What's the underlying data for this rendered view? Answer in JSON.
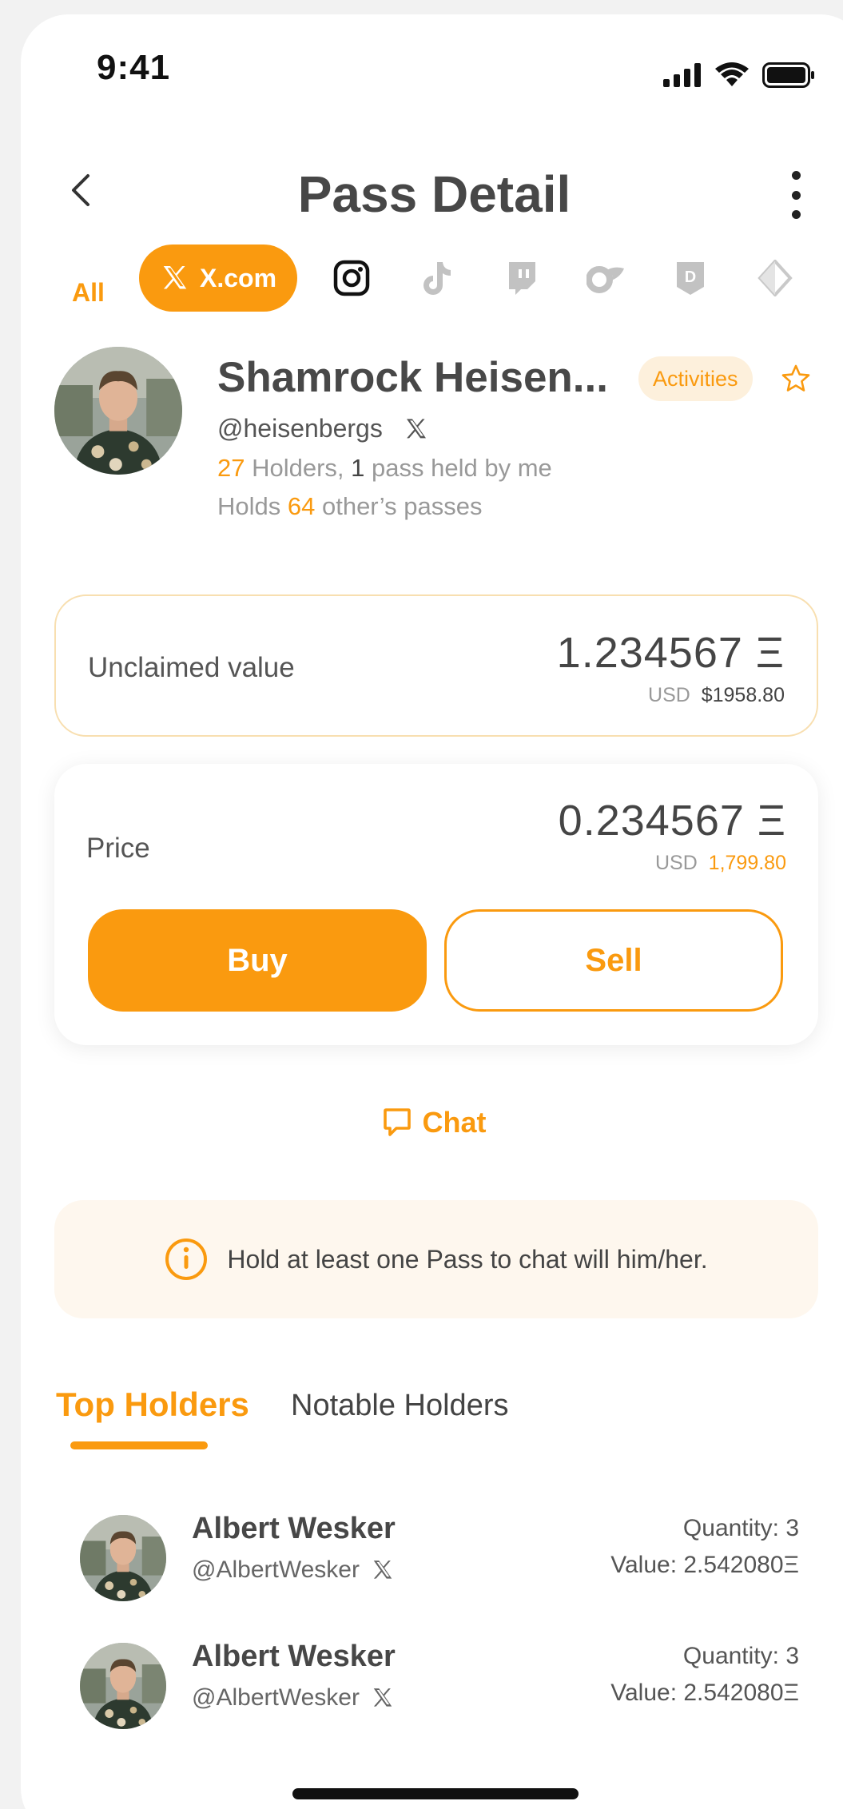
{
  "status_bar": {
    "time": "9:41"
  },
  "header": {
    "title": "Pass Detail"
  },
  "platform_tabs": {
    "all": "All",
    "x": "X.com"
  },
  "profile": {
    "name": "Shamrock Heisen...",
    "handle": "@heisenbergs",
    "activities": "Activities",
    "holders_count": "27",
    "holders_text": " Holders, ",
    "held_by_me": "1",
    "held_text": " pass held by me",
    "holds_prefix": "Holds ",
    "holds_count": "64",
    "holds_suffix": " other’s passes"
  },
  "unclaimed": {
    "label": "Unclaimed value",
    "value": "1.234567 Ξ",
    "usd_label": "USD",
    "usd_value": "$1958.80"
  },
  "price": {
    "label": "Price",
    "value": "0.234567 Ξ",
    "usd_label": "USD",
    "usd_value": "1,799.80"
  },
  "actions": {
    "buy": "Buy",
    "sell": "Sell",
    "chat": "Chat"
  },
  "notice": {
    "text": "Hold at least one Pass to chat will him/her."
  },
  "holder_tabs": {
    "top": "Top Holders",
    "notable": "Notable Holders"
  },
  "holders": [
    {
      "name": "Albert Wesker",
      "handle": "@AlbertWesker",
      "quantity": "Quantity: 3",
      "value": "Value: 2.542080Ξ"
    },
    {
      "name": "Albert Wesker",
      "handle": "@AlbertWesker",
      "quantity": "Quantity: 3",
      "value": "Value: 2.542080Ξ"
    }
  ],
  "colors": {
    "accent": "#fa9a0f",
    "accent_soft": "#fdf0dc",
    "notice_bg": "#fef7ee"
  }
}
